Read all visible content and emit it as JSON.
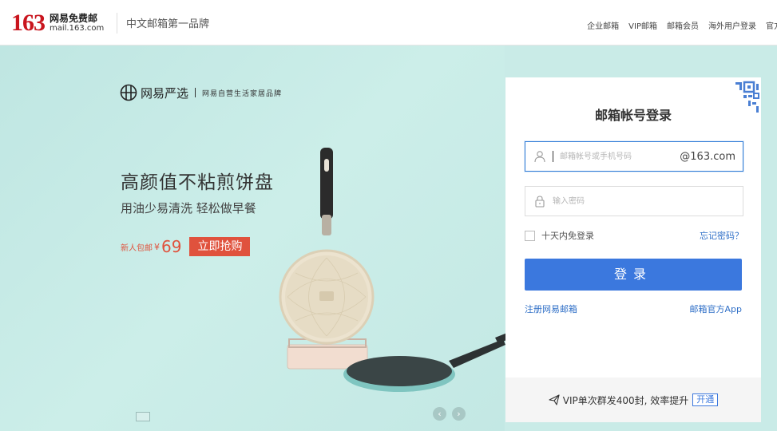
{
  "header": {
    "logo_number": "163",
    "logo_name": "网易免费邮",
    "logo_url": "mail.163.com",
    "slogan": "中文邮箱第一品牌",
    "nav": [
      "企业邮箱",
      "VIP邮箱",
      "邮箱会员",
      "海外用户登录",
      "官方"
    ]
  },
  "promo": {
    "brand": "网易严选",
    "brand_sub": "网易自营生活家居品牌",
    "headline": "高颜值不粘煎饼盘",
    "subline": "用油少易清洗 轻松做早餐",
    "new_user": "新人包邮",
    "currency": "¥",
    "price": "69",
    "buy_label": "立即抢购",
    "accent_color": "#e0523d"
  },
  "login": {
    "title": "邮箱帐号登录",
    "account_placeholder": "邮箱帐号或手机号码",
    "domain_suffix": "@163.com",
    "password_placeholder": "输入密码",
    "remember_label": "十天内免登录",
    "forgot_label": "忘记密码？",
    "submit_label": "登录",
    "register_label": "注册网易邮箱",
    "app_label": "邮箱官方App",
    "footer_text": "VIP单次群发400封, 效率提升",
    "footer_button": "开通",
    "button_color": "#3b78de"
  },
  "icons": {
    "account": "user-icon",
    "password": "lock-icon",
    "qr": "qr-code-icon",
    "footer": "paper-plane-icon"
  }
}
